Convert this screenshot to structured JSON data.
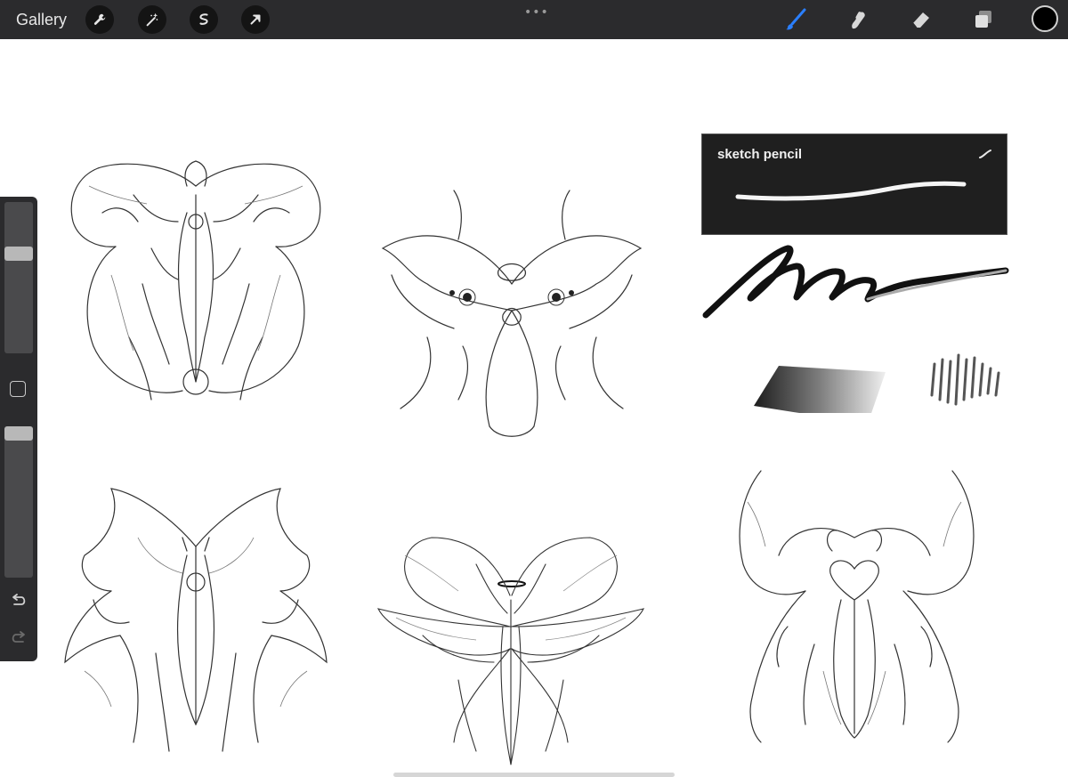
{
  "topbar": {
    "gallery_label": "Gallery",
    "left_tools": [
      "wrench-icon",
      "magic-wand-icon",
      "selection-icon",
      "transform-arrow-icon"
    ],
    "more_dots": "•••",
    "right_tools": [
      "brush-icon",
      "smudge-icon",
      "eraser-icon",
      "layers-icon"
    ],
    "active_tool": "brush-icon",
    "active_tool_color": "#2a7fff",
    "current_color": "#000000"
  },
  "sidebar": {
    "brush_size_level": 0.28,
    "opacity_level": 0.0,
    "tools": [
      "modifier-square-icon",
      "undo-icon",
      "redo-icon"
    ]
  },
  "brush_preview": {
    "name": "sketch pencil"
  },
  "canvas": {
    "background": "#ffffff",
    "sketches": [
      "moth-sketch",
      "winged-crest-sketch",
      "horned-ornament-sketch",
      "angel-moth-sketch",
      "heart-crest-sketch"
    ]
  }
}
